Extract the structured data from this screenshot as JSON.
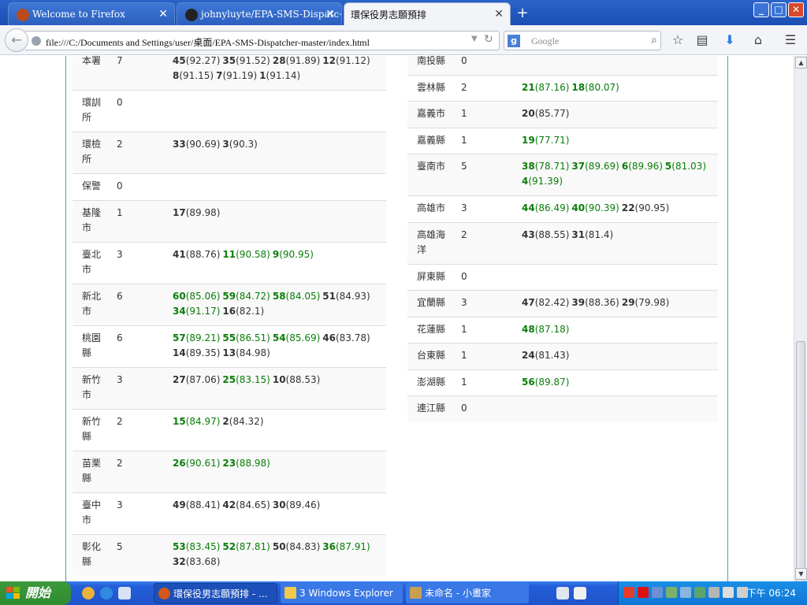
{
  "browser": {
    "tabs": [
      {
        "label": "Welcome to Firefox",
        "active": false
      },
      {
        "label": "johnyluyte/EPA-SMS-Dispatc⋯",
        "active": false
      },
      {
        "label": "環保役男志願預排",
        "active": true
      }
    ],
    "new_tab": "+",
    "url": "file:///C:/Documents and Settings/user/桌面/EPA-SMS-Dispatcher-master/index.html",
    "search_placeholder": "Google",
    "window_buttons": [
      "_",
      "□",
      "✕"
    ]
  },
  "left_rows": [
    {
      "name": "本署",
      "count": "7",
      "lines": [
        [
          {
            "num": "45",
            "score": "(92.27)",
            "high": false
          },
          {
            "num": "35",
            "score": "(91.52)",
            "high": false
          },
          {
            "num": "28",
            "score": "(91.89)",
            "high": false
          },
          {
            "num": "12",
            "score": "(91.12)",
            "high": false
          }
        ],
        [
          {
            "num": "8",
            "score": "(91.15)",
            "high": false
          },
          {
            "num": "7",
            "score": "(91.19)",
            "high": false
          },
          {
            "num": "1",
            "score": "(91.14)",
            "high": false
          }
        ]
      ]
    },
    {
      "name": "環訓所",
      "count": "0",
      "lines": []
    },
    {
      "name": "環檢所",
      "count": "2",
      "lines": [
        [
          {
            "num": "33",
            "score": "(90.69)",
            "high": false
          },
          {
            "num": "3",
            "score": "(90.3)",
            "high": false
          }
        ]
      ]
    },
    {
      "name": "保警",
      "count": "0",
      "lines": []
    },
    {
      "name": "基隆市",
      "count": "1",
      "lines": [
        [
          {
            "num": "17",
            "score": "(89.98)",
            "high": false
          }
        ]
      ]
    },
    {
      "name": "臺北市",
      "count": "3",
      "lines": [
        [
          {
            "num": "41",
            "score": "(88.76)",
            "high": false
          },
          {
            "num": "11",
            "score": "(90.58)",
            "high": true
          },
          {
            "num": "9",
            "score": "(90.95)",
            "high": true
          }
        ]
      ]
    },
    {
      "name": "新北市",
      "count": "6",
      "lines": [
        [
          {
            "num": "60",
            "score": "(85.06)",
            "high": true
          },
          {
            "num": "59",
            "score": "(84.72)",
            "high": true
          },
          {
            "num": "58",
            "score": "(84.05)",
            "high": true
          },
          {
            "num": "51",
            "score": "(84.93)",
            "high": false
          }
        ],
        [
          {
            "num": "34",
            "score": "(91.17)",
            "high": true
          },
          {
            "num": "16",
            "score": "(82.1)",
            "high": false
          }
        ]
      ]
    },
    {
      "name": "桃園縣",
      "count": "6",
      "lines": [
        [
          {
            "num": "57",
            "score": "(89.21)",
            "high": true
          },
          {
            "num": "55",
            "score": "(86.51)",
            "high": true
          },
          {
            "num": "54",
            "score": "(85.69)",
            "high": true
          },
          {
            "num": "46",
            "score": "(83.78)",
            "high": false
          }
        ],
        [
          {
            "num": "14",
            "score": "(89.35)",
            "high": false
          },
          {
            "num": "13",
            "score": "(84.98)",
            "high": false
          }
        ]
      ]
    },
    {
      "name": "新竹市",
      "count": "3",
      "lines": [
        [
          {
            "num": "27",
            "score": "(87.06)",
            "high": false
          },
          {
            "num": "25",
            "score": "(83.15)",
            "high": true
          },
          {
            "num": "10",
            "score": "(88.53)",
            "high": false
          }
        ]
      ]
    },
    {
      "name": "新竹縣",
      "count": "2",
      "lines": [
        [
          {
            "num": "15",
            "score": "(84.97)",
            "high": true
          },
          {
            "num": "2",
            "score": "(84.32)",
            "high": false
          }
        ]
      ]
    },
    {
      "name": "苗栗縣",
      "count": "2",
      "lines": [
        [
          {
            "num": "26",
            "score": "(90.61)",
            "high": true
          },
          {
            "num": "23",
            "score": "(88.98)",
            "high": true
          }
        ]
      ]
    },
    {
      "name": "臺中市",
      "count": "3",
      "lines": [
        [
          {
            "num": "49",
            "score": "(88.41)",
            "high": false
          },
          {
            "num": "42",
            "score": "(84.65)",
            "high": false
          },
          {
            "num": "30",
            "score": "(89.46)",
            "high": false
          }
        ]
      ]
    },
    {
      "name": "彰化縣",
      "count": "5",
      "lines": [
        [
          {
            "num": "53",
            "score": "(83.45)",
            "high": true
          },
          {
            "num": "52",
            "score": "(87.81)",
            "high": true
          },
          {
            "num": "50",
            "score": "(84.83)",
            "high": false
          },
          {
            "num": "36",
            "score": "(87.91)",
            "high": true
          }
        ],
        [
          {
            "num": "32",
            "score": "(83.68)",
            "high": false
          }
        ]
      ]
    }
  ],
  "right_rows": [
    {
      "name": "南投縣",
      "count": "0",
      "lines": []
    },
    {
      "name": "雲林縣",
      "count": "2",
      "lines": [
        [
          {
            "num": "21",
            "score": "(87.16)",
            "high": true
          },
          {
            "num": "18",
            "score": "(80.07)",
            "high": true
          }
        ]
      ]
    },
    {
      "name": "嘉義市",
      "count": "1",
      "lines": [
        [
          {
            "num": "20",
            "score": "(85.77)",
            "high": false
          }
        ]
      ]
    },
    {
      "name": "嘉義縣",
      "count": "1",
      "lines": [
        [
          {
            "num": "19",
            "score": "(77.71)",
            "high": true
          }
        ]
      ]
    },
    {
      "name": "臺南市",
      "count": "5",
      "lines": [
        [
          {
            "num": "38",
            "score": "(78.71)",
            "high": true
          },
          {
            "num": "37",
            "score": "(89.69)",
            "high": true
          },
          {
            "num": "6",
            "score": "(89.96)",
            "high": true
          },
          {
            "num": "5",
            "score": "(81.03)",
            "high": true
          }
        ],
        [
          {
            "num": "4",
            "score": "(91.39)",
            "high": true
          }
        ]
      ]
    },
    {
      "name": "高雄市",
      "count": "3",
      "lines": [
        [
          {
            "num": "44",
            "score": "(86.49)",
            "high": true
          },
          {
            "num": "40",
            "score": "(90.39)",
            "high": true
          },
          {
            "num": "22",
            "score": "(90.95)",
            "high": false
          }
        ]
      ]
    },
    {
      "name": "高雄海洋",
      "count": "2",
      "lines": [
        [
          {
            "num": "43",
            "score": "(88.55)",
            "high": false
          },
          {
            "num": "31",
            "score": "(81.4)",
            "high": false
          }
        ]
      ]
    },
    {
      "name": "屏東縣",
      "count": "0",
      "lines": []
    },
    {
      "name": "宜蘭縣",
      "count": "3",
      "lines": [
        [
          {
            "num": "47",
            "score": "(82.42)",
            "high": false
          },
          {
            "num": "39",
            "score": "(88.36)",
            "high": false
          },
          {
            "num": "29",
            "score": "(79.98)",
            "high": false
          }
        ]
      ]
    },
    {
      "name": "花蓮縣",
      "count": "1",
      "lines": [
        [
          {
            "num": "48",
            "score": "(87.18)",
            "high": true
          }
        ]
      ]
    },
    {
      "name": "台東縣",
      "count": "1",
      "lines": [
        [
          {
            "num": "24",
            "score": "(81.43)",
            "high": false
          }
        ]
      ]
    },
    {
      "name": "澎湖縣",
      "count": "1",
      "lines": [
        [
          {
            "num": "56",
            "score": "(89.87)",
            "high": true
          }
        ]
      ]
    },
    {
      "name": "連江縣",
      "count": "0",
      "lines": []
    }
  ],
  "taskbar": {
    "start_label": "開始",
    "tasks": [
      "環保役男志願預排 - ...",
      "3  Windows Explorer",
      "未命名 - 小畫家"
    ],
    "clock": "下午 06:24"
  },
  "colors": {
    "high": "#0a7d0a",
    "panel_border": "#4aa3a8",
    "taskbar": "#245edb",
    "start": "#3c9a3c"
  }
}
